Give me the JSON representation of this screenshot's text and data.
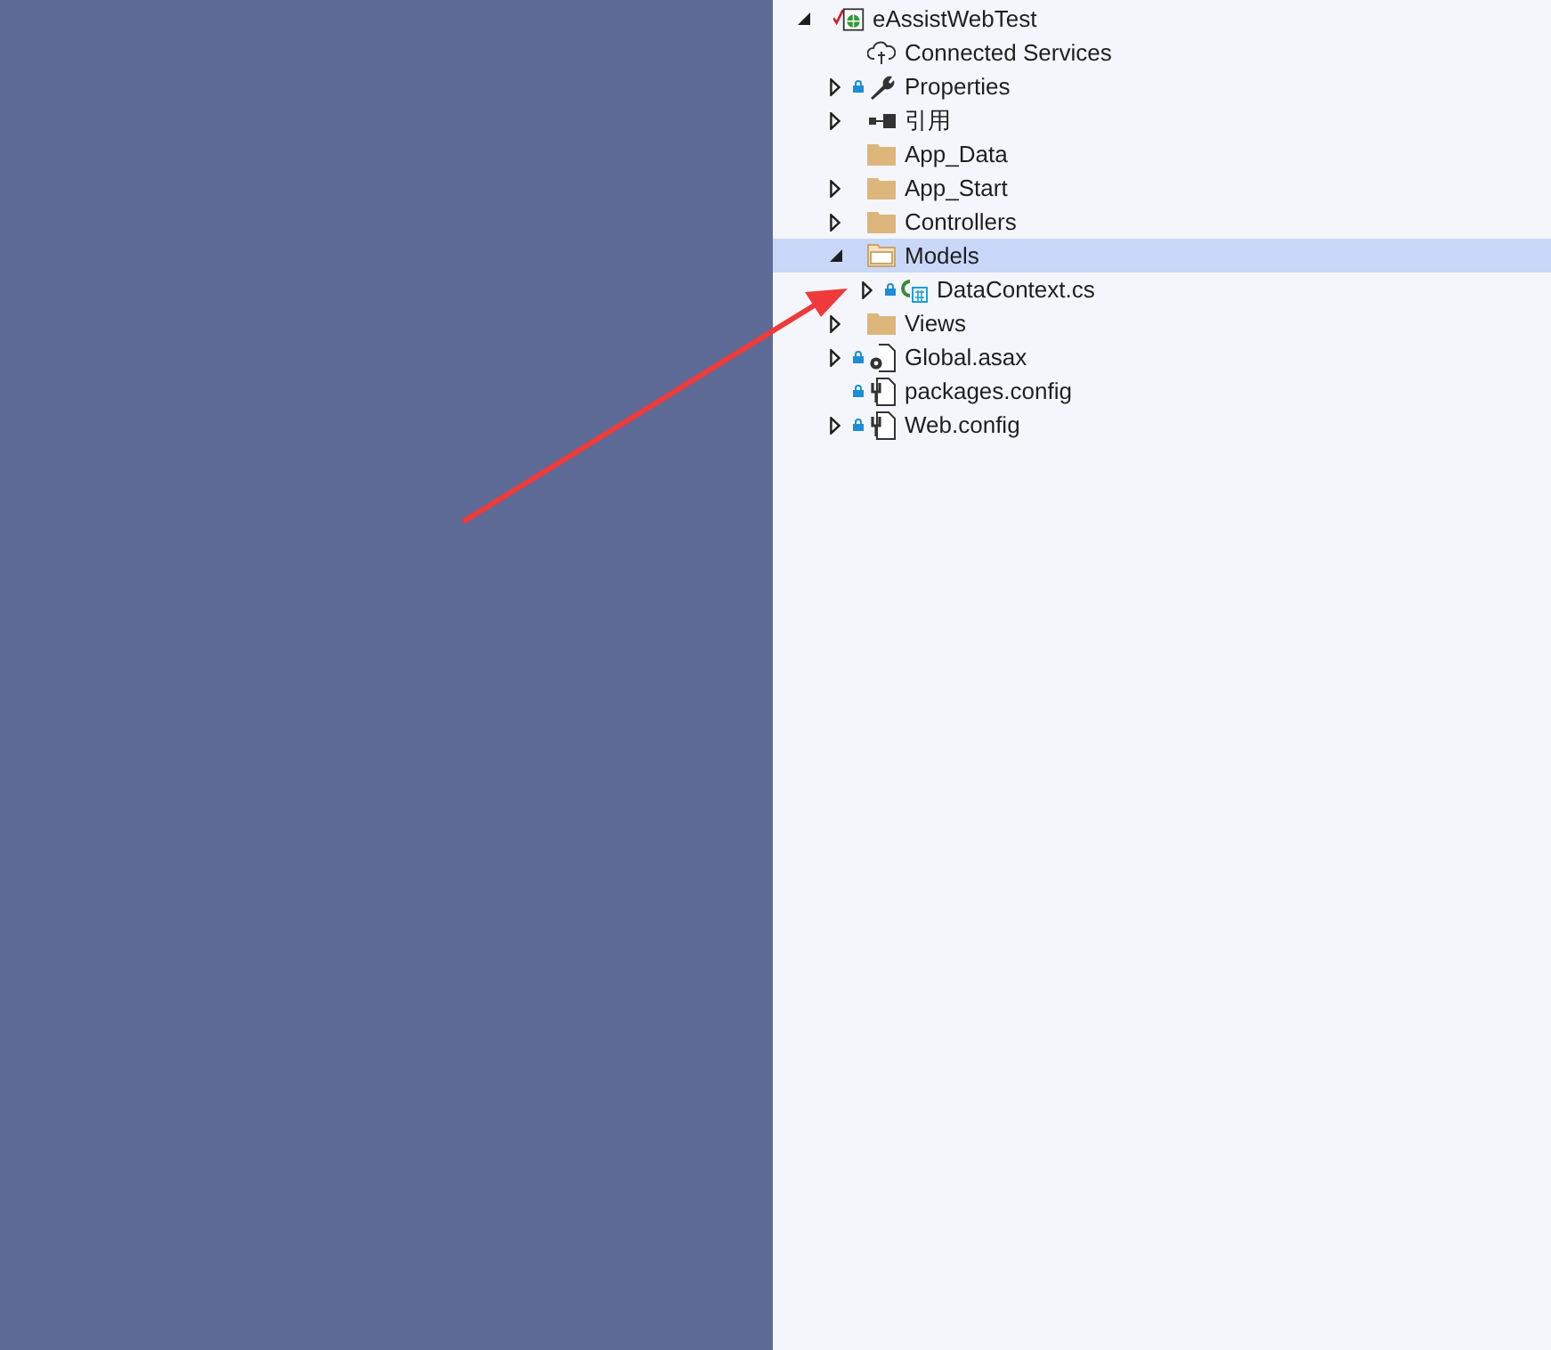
{
  "solution_explorer": {
    "tree": [
      {
        "label": "eAssistWebTest",
        "kind": "project",
        "expanded": true,
        "locked": false,
        "selected": false,
        "children": [
          {
            "label": "Connected Services",
            "kind": "cloud",
            "locked": false,
            "selected": false
          },
          {
            "label": "Properties",
            "kind": "wrench",
            "expanded": false,
            "locked": true,
            "selected": false
          },
          {
            "label": "引用",
            "kind": "reference",
            "expanded": false,
            "locked": false,
            "selected": false
          },
          {
            "label": "App_Data",
            "kind": "folder",
            "locked": false,
            "selected": false
          },
          {
            "label": "App_Start",
            "kind": "folder",
            "expanded": false,
            "locked": false,
            "selected": false
          },
          {
            "label": "Controllers",
            "kind": "folder",
            "expanded": false,
            "locked": false,
            "selected": false
          },
          {
            "label": "Models",
            "kind": "folder-open",
            "expanded": true,
            "locked": false,
            "selected": true,
            "children": [
              {
                "label": "DataContext.cs",
                "kind": "csharp",
                "expanded": false,
                "locked": true,
                "selected": false
              }
            ]
          },
          {
            "label": "Views",
            "kind": "folder",
            "expanded": false,
            "locked": false,
            "selected": false
          },
          {
            "label": "Global.asax",
            "kind": "asax",
            "expanded": false,
            "locked": true,
            "selected": false
          },
          {
            "label": "packages.config",
            "kind": "config",
            "locked": true,
            "selected": false
          },
          {
            "label": "Web.config",
            "kind": "config",
            "expanded": false,
            "locked": true,
            "selected": false
          }
        ]
      }
    ]
  }
}
